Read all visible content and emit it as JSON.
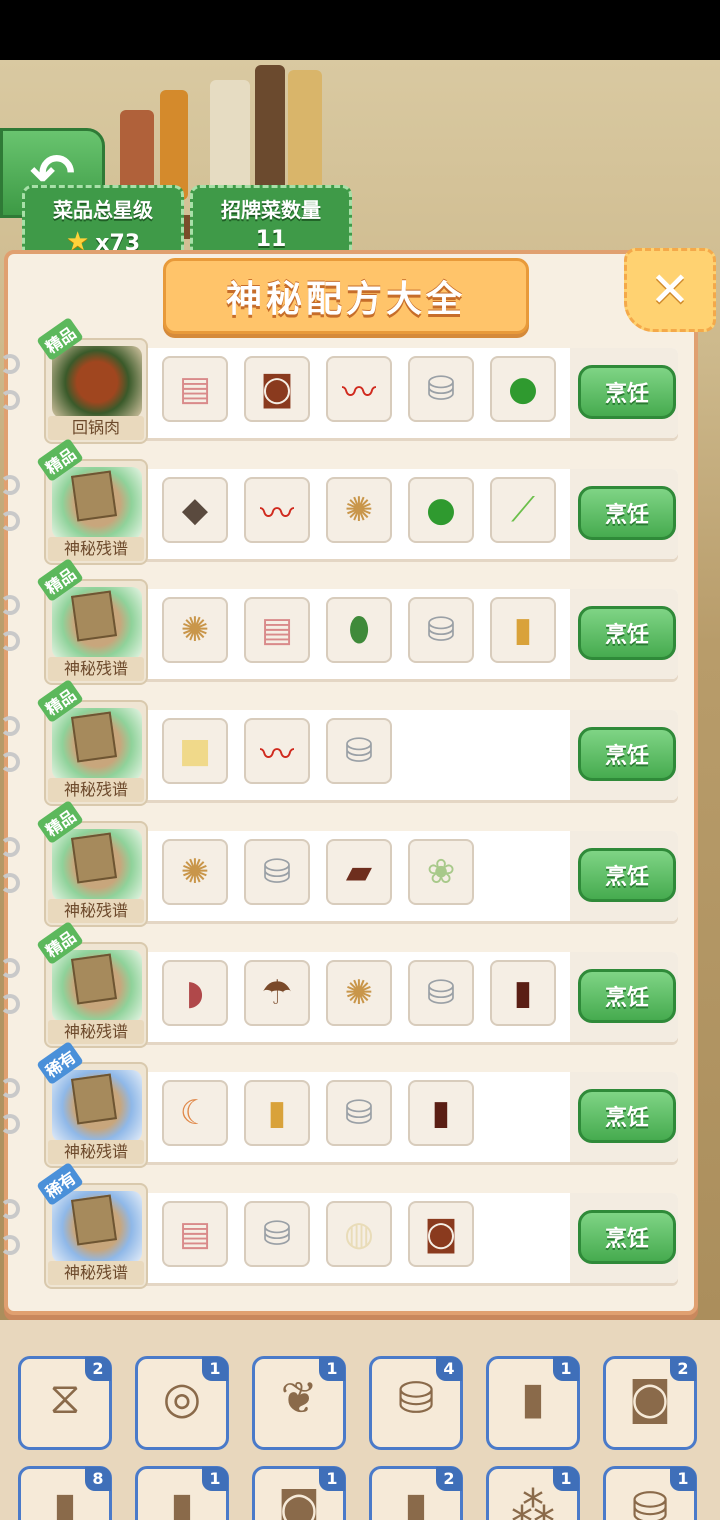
{
  "stats": {
    "star_label": "菜品总星级",
    "star_value": "x73",
    "signature_label": "招牌菜数量",
    "signature_value": "11"
  },
  "panel": {
    "title": "神秘配方大全",
    "close_glyph": "✕",
    "back_glyph": "↶",
    "cook_label": "烹饪"
  },
  "recipes": [
    {
      "grade": "精品",
      "name": "回锅肉",
      "ingredients": [
        "pork-belly",
        "bean-paste-jar",
        "red-chili",
        "salt-shaker",
        "green-pepper"
      ]
    },
    {
      "grade": "精品",
      "name": "神秘残谱",
      "ingredients": [
        "fish",
        "red-chili",
        "ginger",
        "green-pepper",
        "scallion"
      ]
    },
    {
      "grade": "精品",
      "name": "神秘残谱",
      "ingredients": [
        "ginger",
        "pork-belly",
        "cucumber",
        "salt-shaker",
        "cooking-wine-bottle"
      ]
    },
    {
      "grade": "精品",
      "name": "神秘残谱",
      "ingredients": [
        "tofu",
        "red-chili",
        "salt-shaker"
      ]
    },
    {
      "grade": "精品",
      "name": "神秘残谱",
      "ingredients": [
        "ginger",
        "salt-shaker",
        "cured-meat",
        "cauliflower"
      ]
    },
    {
      "grade": "精品",
      "name": "神秘残谱",
      "ingredients": [
        "beef",
        "mushroom",
        "ginger",
        "salt-shaker",
        "soy-sauce-bottle"
      ]
    },
    {
      "grade": "稀有",
      "name": "神秘残谱",
      "ingredients": [
        "shrimp",
        "cooking-wine-bottle",
        "salt-shaker",
        "soy-sauce-bottle"
      ]
    },
    {
      "grade": "稀有",
      "name": "神秘残谱",
      "ingredients": [
        "pork-belly",
        "salt-shaker",
        "bun-dough",
        "bean-paste-jar"
      ]
    }
  ],
  "inventory": [
    {
      "icon": "yam-icon",
      "count": "2"
    },
    {
      "icon": "flour-wrappers-icon",
      "count": "1"
    },
    {
      "icon": "cabbage-icon",
      "count": "1"
    },
    {
      "icon": "salt-shaker-icon",
      "count": "4"
    },
    {
      "icon": "cooking-wine-bottle-icon",
      "count": "1"
    },
    {
      "icon": "bean-paste-jar-icon",
      "count": "2"
    },
    {
      "icon": "soy-sauce-bottle-icon",
      "count": "8"
    },
    {
      "icon": "vinegar-bottle-icon",
      "count": "1"
    },
    {
      "icon": "sauce-jar-icon",
      "count": "1"
    },
    {
      "icon": "oil-bottle-icon",
      "count": "2"
    },
    {
      "icon": "sichuan-pepper-icon",
      "count": "1"
    },
    {
      "icon": "pepper-shaker-icon",
      "count": "1"
    }
  ],
  "colors": {
    "panel_bg": "#f7efe2",
    "title_banner": "#ffc46a",
    "cook_button": "#46ab4f",
    "inventory_border": "#4a7ac9"
  }
}
